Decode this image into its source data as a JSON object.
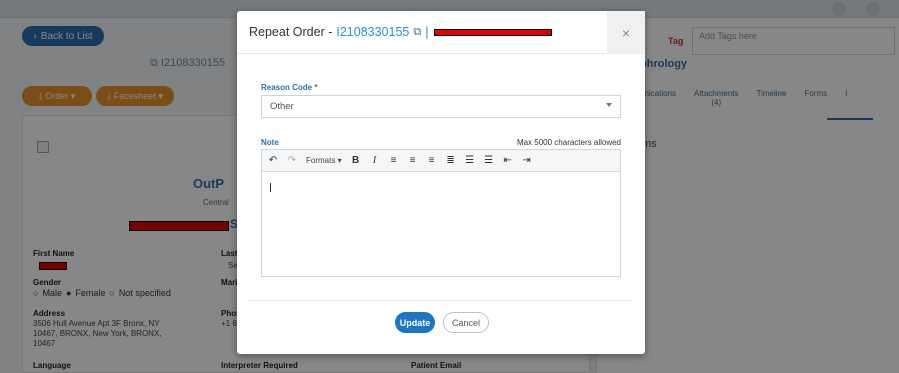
{
  "background": {
    "back_label": "Back to List",
    "order_id": "I2108330155",
    "order_btn": "Order",
    "facesheet_btn": "Facesheet",
    "outp": "OutP",
    "central": "Central",
    "s_letter": "S",
    "first_name_label": "First Name",
    "last_label": "Last",
    "last_value": "Se",
    "gender_label": "Gender",
    "mari_label": "Mari",
    "gender_options": [
      "Male",
      "Female",
      "Not specified"
    ],
    "address_label": "Address",
    "address_value_1": "3506 Hull Avenue Apt 3F Bronx, NY",
    "address_value_2": "10467, BRONX, New York, BRONX,",
    "address_value_3": "10467",
    "phone_label": "Phon",
    "phone_value": "+1 6",
    "language_label": "Language",
    "interpreter_label": "Interpreter Required",
    "patient_email_label": "Patient Email"
  },
  "right_panel": {
    "tag_label": "Tag",
    "add_tags_placeholder": "Add Tags here",
    "section": "phrology",
    "tabs": [
      "unications",
      "Attachments",
      "Timeline",
      "Forms",
      "I"
    ],
    "attachments_count": "(4)",
    "ms_text": "ms"
  },
  "modal": {
    "title": "Repeat Order -",
    "order_id": "I2108330155",
    "pipe": "|",
    "reason_label": "Reason Code",
    "required_mark": "*",
    "reason_value": "Other",
    "note_label": "Note",
    "max_chars": "Max 5000 characters allowed",
    "formats_label": "Formats",
    "update_label": "Update",
    "cancel_label": "Cancel",
    "close_glyph": "×"
  }
}
